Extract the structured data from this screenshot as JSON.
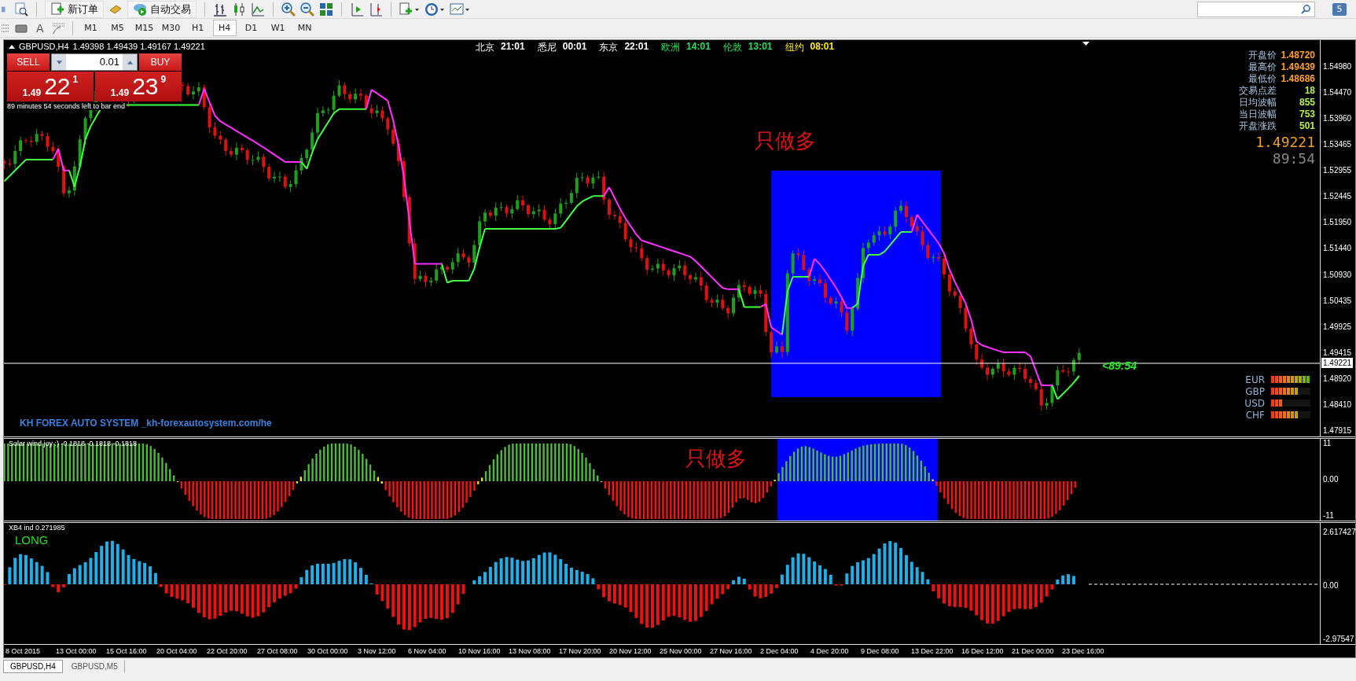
{
  "toolbar": {
    "buttons": [
      {
        "label": "新订单"
      },
      {
        "label": "自动交易"
      }
    ],
    "text_tool": "A",
    "notifications": "5",
    "periods": [
      {
        "label": "M1",
        "selected": false
      },
      {
        "label": "M5",
        "selected": false
      },
      {
        "label": "M15",
        "selected": false
      },
      {
        "label": "M30",
        "selected": false
      },
      {
        "label": "H1",
        "selected": false
      },
      {
        "label": "H4",
        "selected": true
      },
      {
        "label": "D1",
        "selected": false
      },
      {
        "label": "W1",
        "selected": false
      },
      {
        "label": "MN",
        "selected": false
      }
    ]
  },
  "chart": {
    "title": "GBPUSD,H4",
    "ohlc": "1.49398 1.49439 1.49167 1.49221",
    "trade_panel": {
      "sell": {
        "label": "SELL",
        "prefix": "1.49",
        "big": "22",
        "pip": "1"
      },
      "buy": {
        "label": "BUY",
        "prefix": "1.49",
        "big": "23",
        "pip": "9"
      },
      "lot": "0.01",
      "countdown": "89 minutes 54 seconds left to bar end"
    },
    "sessions": [
      {
        "city": "北京",
        "time": "21:01",
        "color": "#ffffff"
      },
      {
        "city": "悉尼",
        "time": "00:01",
        "color": "#ffffff"
      },
      {
        "city": "东京",
        "time": "22:01",
        "color": "#ffffff"
      },
      {
        "city": "欧洲",
        "time": "14:01",
        "color": "#22e05a"
      },
      {
        "city": "伦敦",
        "time": "13:01",
        "color": "#22e05a"
      },
      {
        "city": "纽约",
        "time": "08:01",
        "color": "#ffee00"
      }
    ],
    "stats": [
      {
        "label": "开盘价",
        "value": "1.48720",
        "color": "#ffa020"
      },
      {
        "label": "最高价",
        "value": "1.49439",
        "color": "#ffa020"
      },
      {
        "label": "最低价",
        "value": "1.48686",
        "color": "#ffa020"
      },
      {
        "label": "交易点差",
        "value": "18",
        "color": "#b8f040"
      },
      {
        "label": "日均波幅",
        "value": "855",
        "color": "#b8f040"
      },
      {
        "label": "当日波幅",
        "value": "753",
        "color": "#b8f040"
      },
      {
        "label": "开盘涨跌",
        "value": "501",
        "color": "#b8f040"
      }
    ],
    "last_price": "1.49221",
    "timer": "89:54",
    "timer_tag": "<89:54",
    "system_label": "KH FOREX AUTO SYSTEM _kh-forexautosystem.com/he",
    "annotation": "只做多",
    "price_axis": [
      "1.54980",
      "1.54470",
      "1.53960",
      "1.53465",
      "1.52955",
      "1.52445",
      "1.51950",
      "1.51440",
      "1.50930",
      "1.50435",
      "1.49925",
      "1.49415",
      "1.48920",
      "1.48410",
      "1.47915"
    ],
    "current_price_tag": "1.49221",
    "currency_strength": [
      {
        "currency": "EUR",
        "level": 1.0
      },
      {
        "currency": "GBP",
        "level": 0.7
      },
      {
        "currency": "USD",
        "level": 0.3
      },
      {
        "currency": "CHF",
        "level": 0.7
      }
    ]
  },
  "indicator_1": {
    "title": "Solar wind joy :) -0.1818 -0.1818 -0.1818",
    "annotation": "只做多",
    "axis": [
      "11",
      "0.00",
      "-11"
    ]
  },
  "indicator_2": {
    "title": "XB4 ind 0.271985",
    "signal": "LONG",
    "axis": [
      "2.617427",
      "0.00",
      "-2.97547"
    ]
  },
  "time_axis": [
    "8 Oct 2015",
    "13 Oct 00:00",
    "15 Oct 16:00",
    "20 Oct 04:00",
    "22 Oct 20:00",
    "27 Oct 08:00",
    "30 Oct 00:00",
    "3 Nov 12:00",
    "6 Nov 04:00",
    "10 Nov 16:00",
    "13 Nov 08:00",
    "17 Nov 20:00",
    "20 Nov 12:00",
    "25 Nov 00:00",
    "27 Nov 16:00",
    "2 Dec 04:00",
    "4 Dec 20:00",
    "9 Dec 08:00",
    "13 Dec 22:00",
    "16 Dec 12:00",
    "21 Dec 00:00",
    "23 Dec 16:00"
  ],
  "tabs": [
    {
      "label": "GBPUSD,H4",
      "selected": true
    },
    {
      "label": "GBPUSD,M5",
      "selected": false
    }
  ]
}
